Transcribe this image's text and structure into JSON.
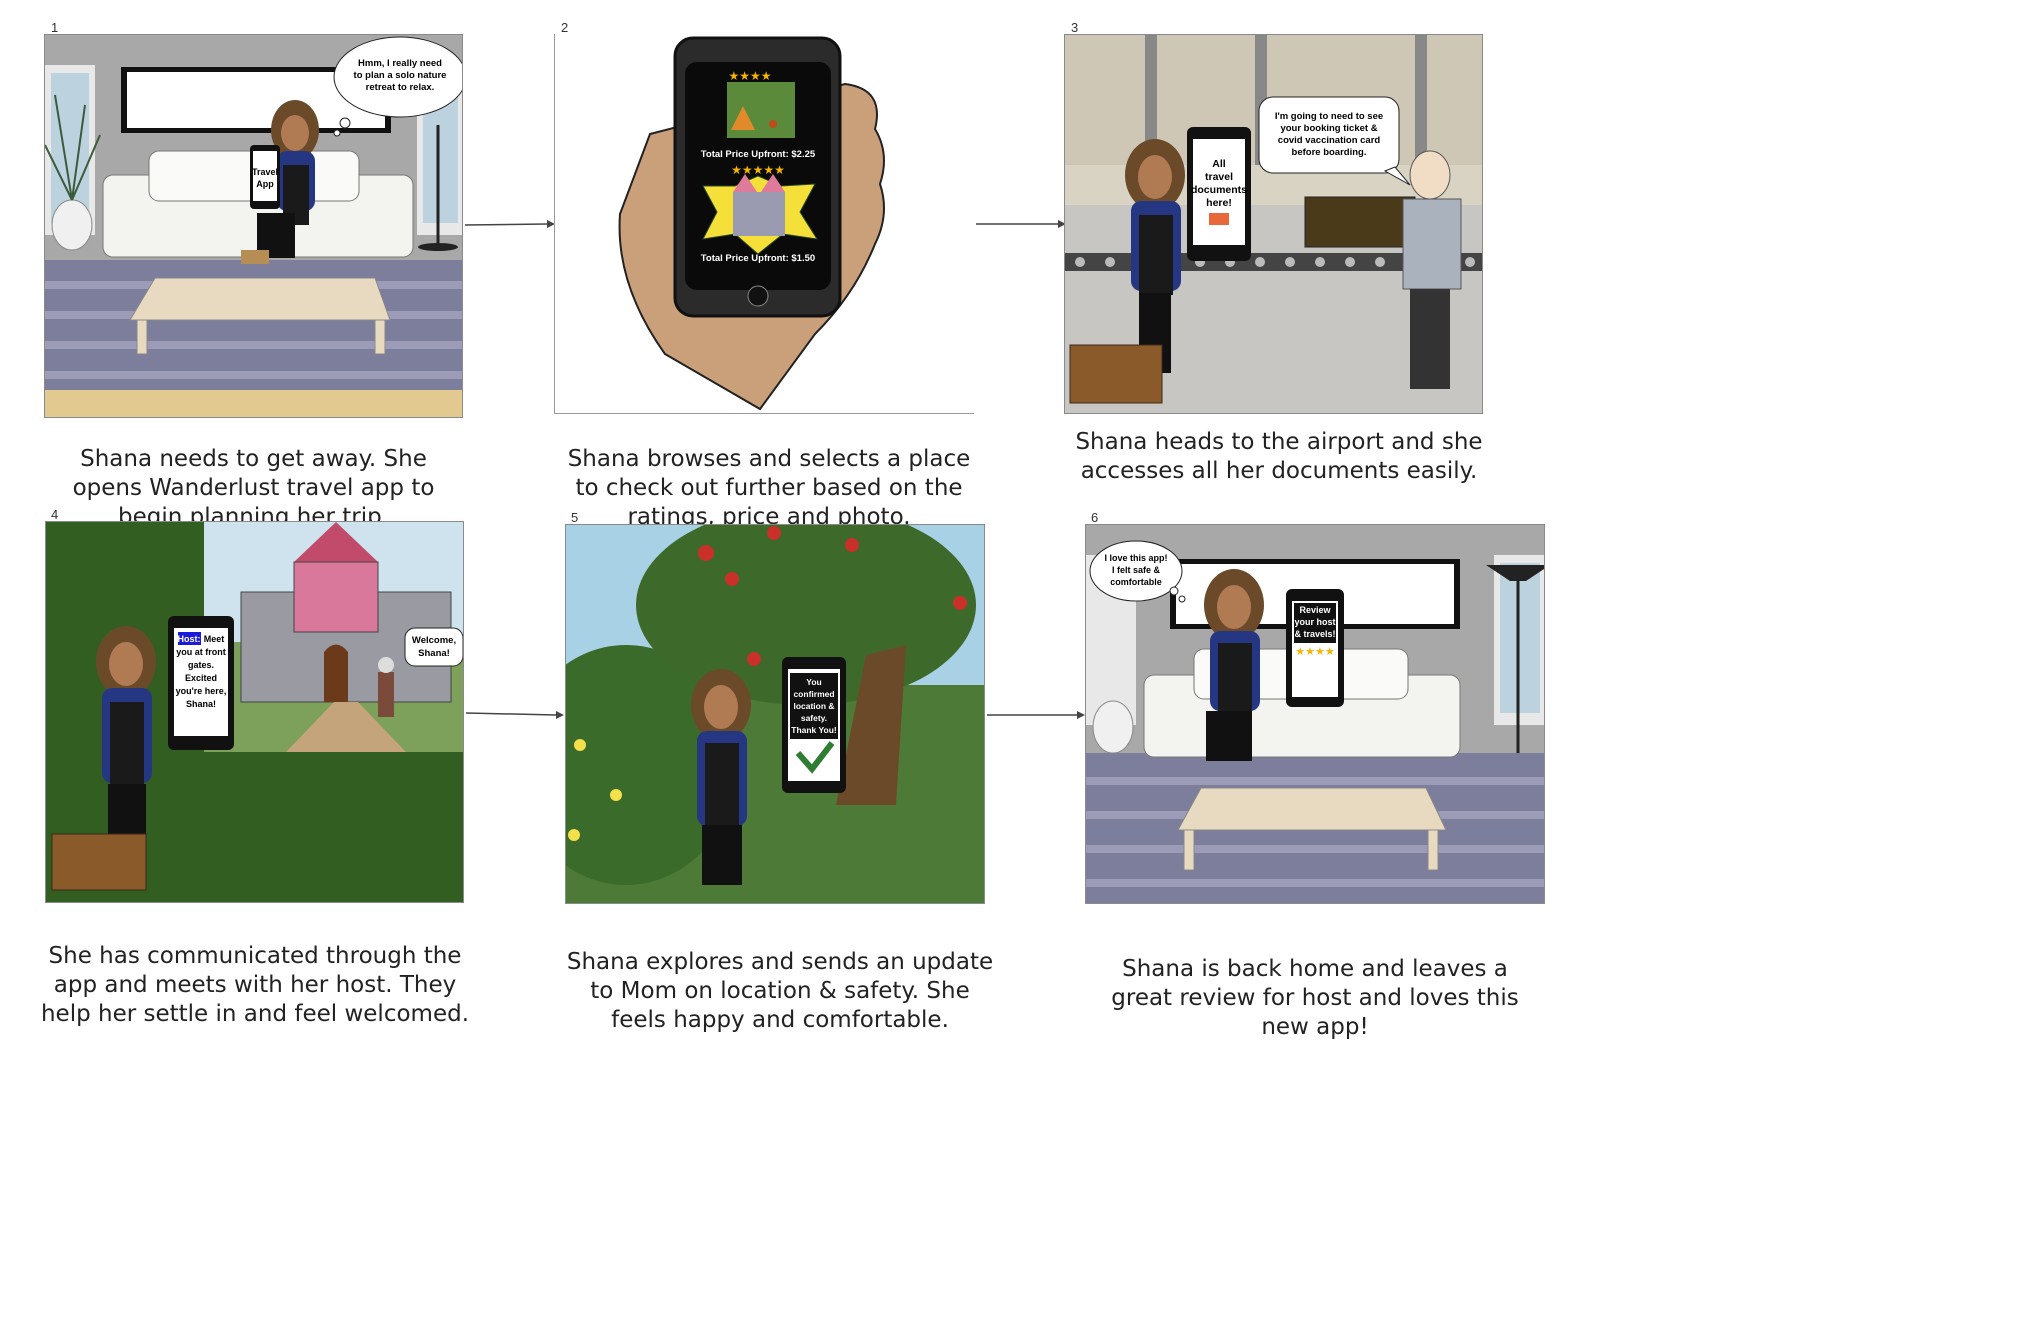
{
  "panels": [
    {
      "number": "1",
      "speech": [
        "Hmm, I really need",
        "to plan a solo nature",
        "retreat to relax."
      ],
      "phone": [
        "Travel",
        "App"
      ],
      "caption": "Shana needs to get away. She opens Wanderlust travel app to begin planning her trip."
    },
    {
      "number": "2",
      "listing1_rating": "★★★★",
      "listing1_price": "Total Price Upfront: $2.25",
      "listing2_rating": "★★★★★",
      "listing2_price": "Total Price Upfront: $1.50",
      "caption": "Shana browses and selects a place to check out further based on the ratings, price and photo."
    },
    {
      "number": "3",
      "phone": [
        "All",
        "travel",
        "documents",
        "here!"
      ],
      "speech": [
        "I'm going to need to see",
        "your booking ticket &",
        "covid vaccination card",
        "before boarding."
      ],
      "caption": "Shana heads to the airport and she accesses all her documents easily."
    },
    {
      "number": "4",
      "phone_highlight": "Host:",
      "phone": [
        "Meet",
        "you at front",
        "gates.",
        "Excited",
        "you're here,",
        "Shana!"
      ],
      "speech": [
        "Welcome,",
        "Shana!"
      ],
      "caption": "She has communicated through the app and meets with her host. They help her settle in and feel welcomed."
    },
    {
      "number": "5",
      "phone": [
        "You",
        "confirmed",
        "location &",
        "safety.",
        "Thank You!"
      ],
      "caption": "Shana explores and sends an update to Mom on location & safety. She feels happy and comfortable."
    },
    {
      "number": "6",
      "thought": [
        "I love this app!",
        "I felt safe &",
        "comfortable"
      ],
      "phone": [
        "Review",
        "your host",
        "& travels!"
      ],
      "phone_rating": "★★★★",
      "caption": "Shana is back home and leaves a great review for host and loves this new app!"
    }
  ],
  "colors": {
    "accent_highlight": "#1a1adb",
    "star": "#f4b400",
    "check": "#2e7d32",
    "floor": "#7d7d9c",
    "wall": "#a9a9a9",
    "grass": "#3b6b2a"
  }
}
